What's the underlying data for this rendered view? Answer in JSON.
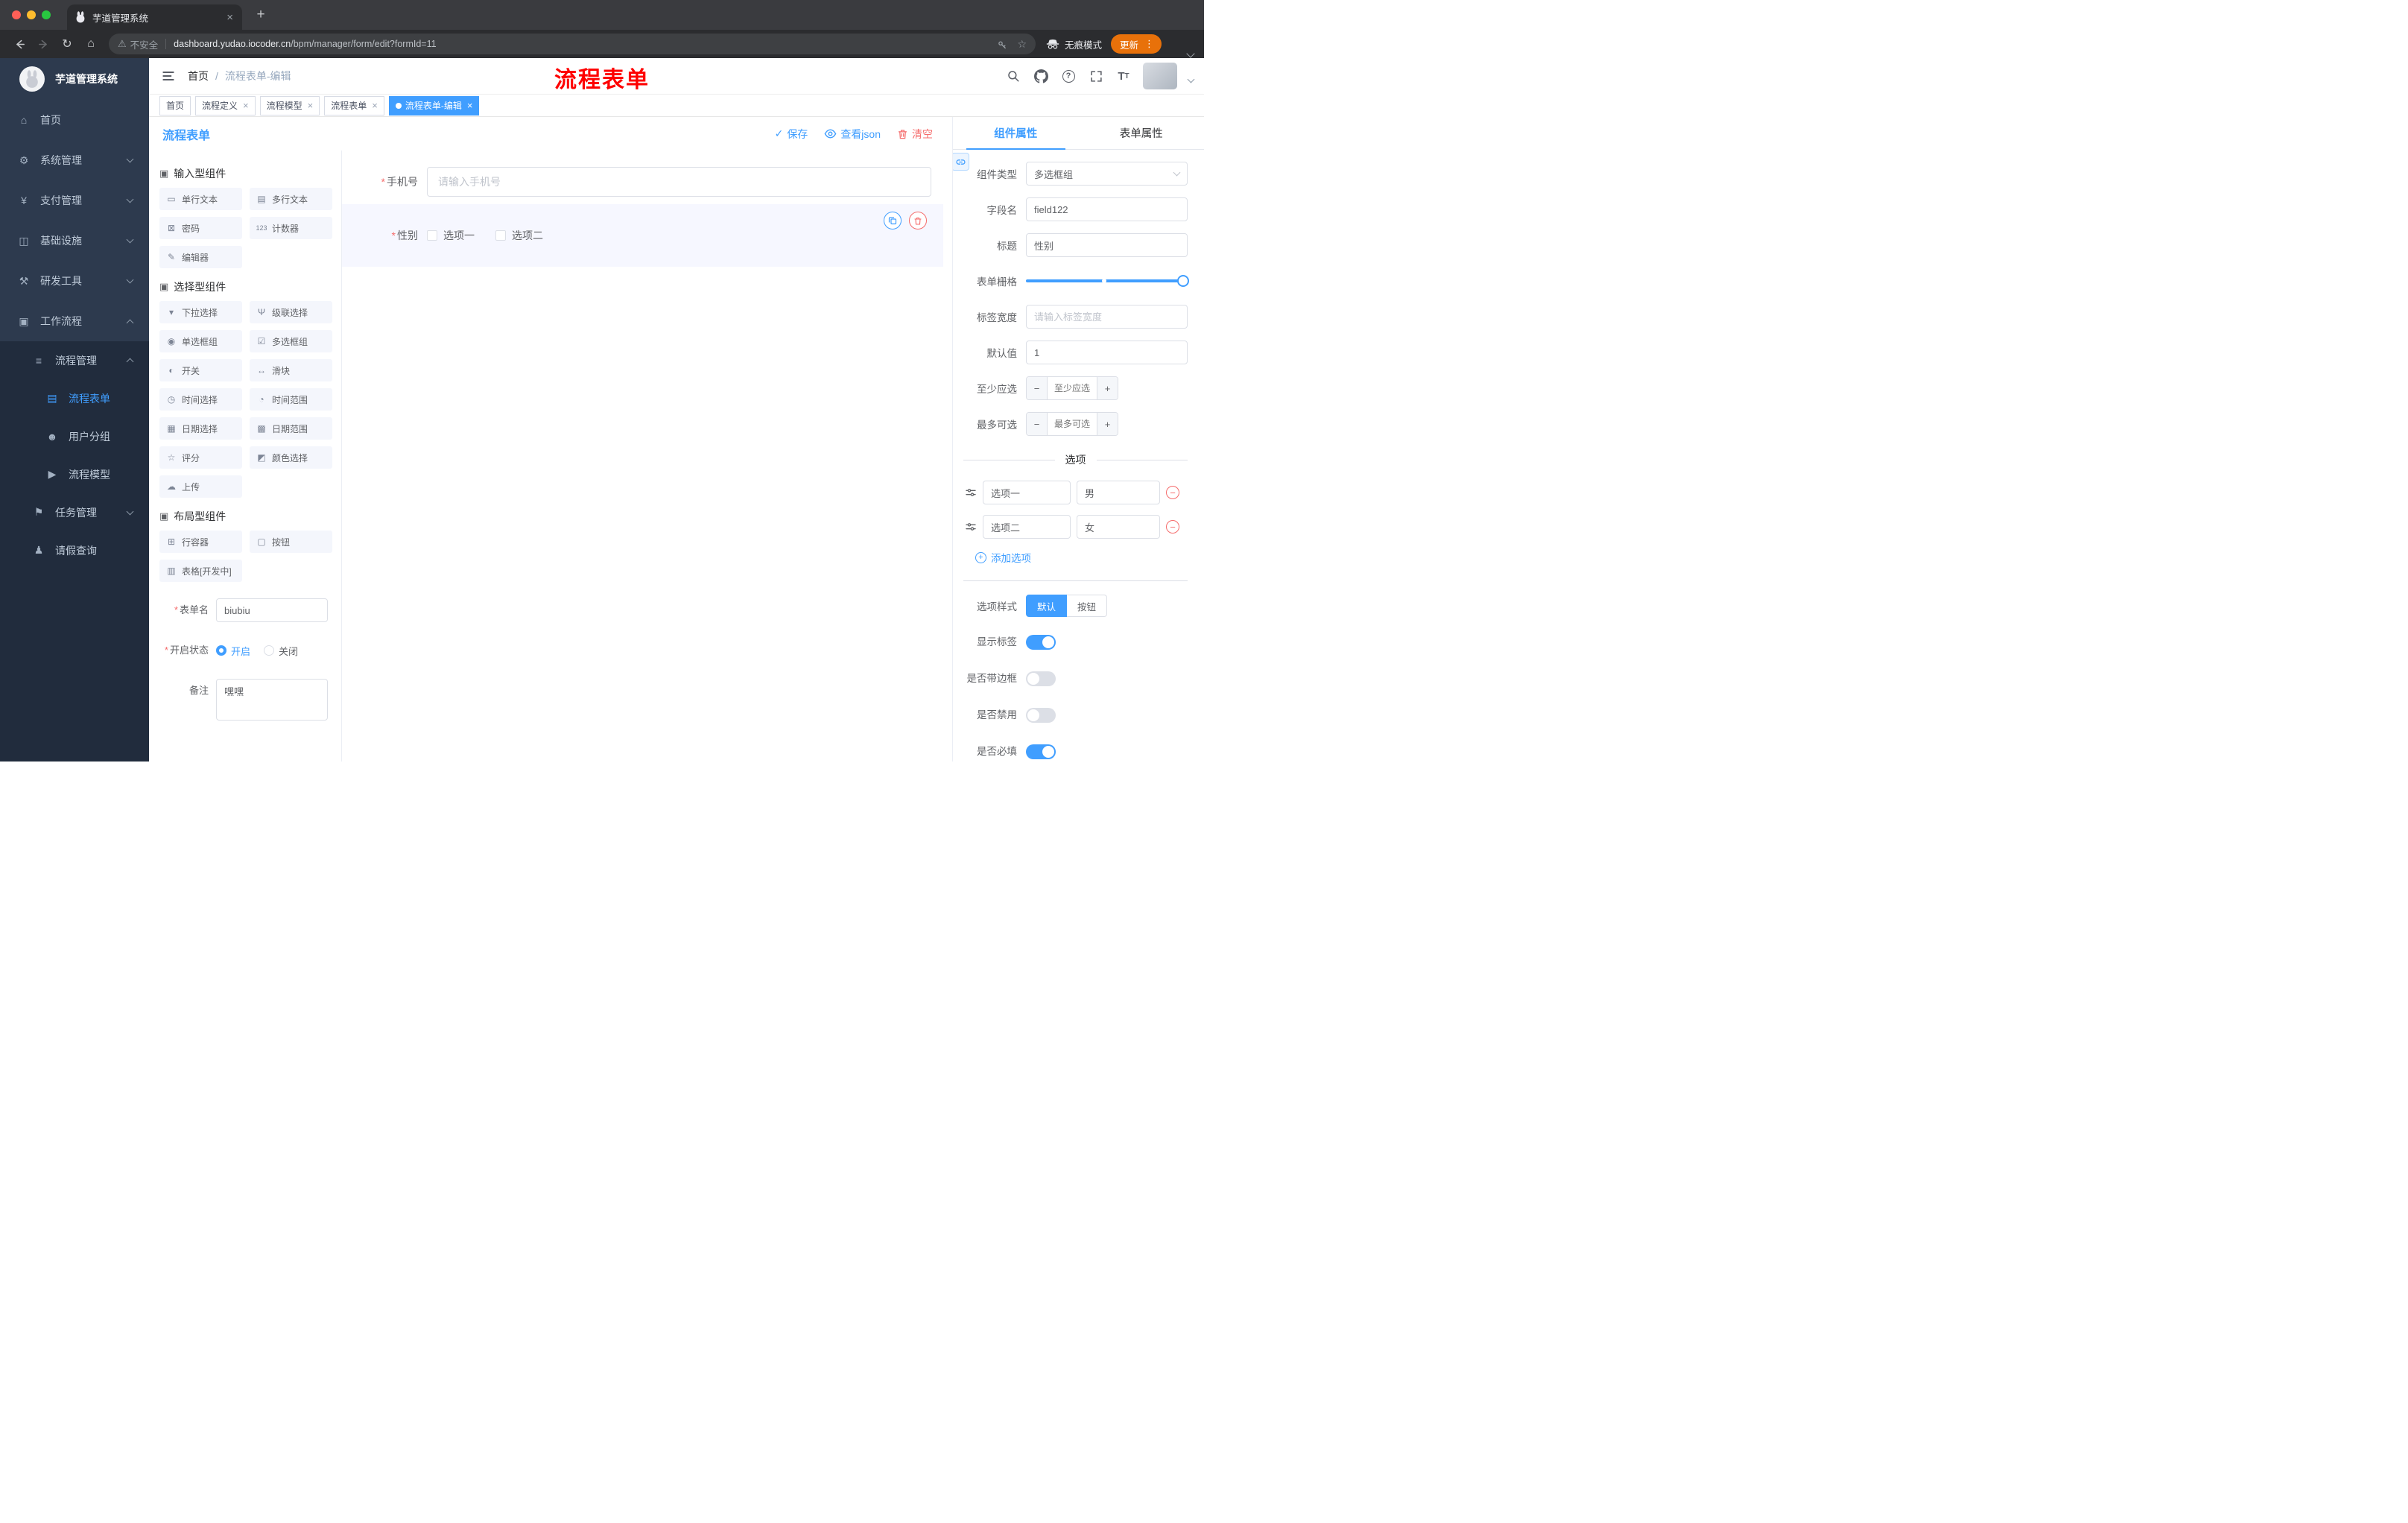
{
  "glyphs": {
    "close": "×",
    "plus": "+",
    "minus": "−",
    "check": "✓",
    "question": "?",
    "kebab": "⋮",
    "reload": "↻",
    "home": "⌂",
    "warning": "⚠",
    "star": "☆",
    "required": "*",
    "text_icon": "T"
  },
  "browser": {
    "tab_title": "芋道管理系统",
    "security_label": "不安全",
    "url_domain": "dashboard.yudao.iocoder.cn",
    "url_path": "/bpm/manager/form/edit?formId=11",
    "incognito_label": "无痕模式",
    "update_label": "更新"
  },
  "sidebar": {
    "logo_title": "芋道管理系统",
    "items": [
      {
        "glyph": "⌂",
        "label": "首页"
      },
      {
        "glyph": "⚙",
        "label": "系统管理"
      },
      {
        "glyph": "¥",
        "label": "支付管理"
      },
      {
        "glyph": "◫",
        "label": "基础设施"
      },
      {
        "glyph": "⚒",
        "label": "研发工具"
      },
      {
        "glyph": "▣",
        "label": "工作流程"
      },
      {
        "glyph": "≡",
        "label": "流程管理"
      },
      {
        "glyph": "▤",
        "label": "流程表单"
      },
      {
        "glyph": "☻",
        "label": "用户分组"
      },
      {
        "glyph": "▶",
        "label": "流程模型"
      },
      {
        "glyph": "⚑",
        "label": "任务管理"
      },
      {
        "glyph": "♟",
        "label": "请假查询"
      }
    ]
  },
  "header": {
    "breadcrumb_home": "首页",
    "breadcrumb_sep": "/",
    "breadcrumb_current": "流程表单-编辑",
    "annotation": "流程表单"
  },
  "tags": {
    "items": [
      {
        "label": "首页"
      },
      {
        "label": "流程定义"
      },
      {
        "label": "流程模型"
      },
      {
        "label": "流程表单"
      },
      {
        "label": "流程表单-编辑"
      }
    ]
  },
  "editor": {
    "title": "流程表单",
    "actions": {
      "save": "保存",
      "view_json": "查看json",
      "clear": "清空"
    },
    "palette": {
      "sections": [
        {
          "title": "输入型组件",
          "items": [
            {
              "glyph": "▭",
              "label": "单行文本"
            },
            {
              "glyph": "▤",
              "label": "多行文本"
            },
            {
              "glyph": "⊠",
              "label": "密码"
            },
            {
              "glyph": "123",
              "label": "计数器"
            },
            {
              "glyph": "✎",
              "label": "编辑器"
            }
          ]
        },
        {
          "title": "选择型组件",
          "items": [
            {
              "glyph": "▾",
              "label": "下拉选择"
            },
            {
              "glyph": "Ψ",
              "label": "级联选择"
            },
            {
              "glyph": "◉",
              "label": "单选框组"
            },
            {
              "glyph": "☑",
              "label": "多选框组"
            },
            {
              "glyph": "◐",
              "label": "开关"
            },
            {
              "glyph": "↔",
              "label": "滑块"
            },
            {
              "glyph": "◷",
              "label": "时间选择"
            },
            {
              "glyph": "◔",
              "label": "时间范围"
            },
            {
              "glyph": "▦",
              "label": "日期选择"
            },
            {
              "glyph": "▩",
              "label": "日期范围"
            },
            {
              "glyph": "☆",
              "label": "评分"
            },
            {
              "glyph": "◩",
              "label": "颜色选择"
            },
            {
              "glyph": "☁",
              "label": "上传"
            }
          ]
        },
        {
          "title": "布局型组件",
          "items": [
            {
              "glyph": "⊞",
              "label": "行容器"
            },
            {
              "glyph": "▢",
              "label": "按钮"
            },
            {
              "glyph": "▥",
              "label": "表格[开发中]"
            }
          ]
        }
      ]
    },
    "meta": {
      "form_name_label": "表单名",
      "form_name_value": "biubiu",
      "status_label": "开启状态",
      "status_on": "开启",
      "status_off": "关闭",
      "remark_label": "备注",
      "remark_value": "嘿嘿"
    },
    "canvas": {
      "phone_label": "手机号",
      "phone_placeholder": "请输入手机号",
      "gender_label": "性别",
      "gender_option1": "选项一",
      "gender_option2": "选项二"
    },
    "props": {
      "tab_component": "组件属性",
      "tab_form": "表单属性",
      "component_type_label": "组件类型",
      "component_type_value": "多选框组",
      "field_name_label": "字段名",
      "field_name_value": "field122",
      "title_label": "标题",
      "title_value": "性别",
      "grid_label": "表单栅格",
      "label_width_label": "标签宽度",
      "label_width_placeholder": "请输入标签宽度",
      "default_label": "默认值",
      "default_value": "1",
      "min_label": "至少应选",
      "min_placeholder": "至少应选",
      "max_label": "最多可选",
      "max_placeholder": "最多可选",
      "options_divider": "选项",
      "options": [
        {
          "name": "选项一",
          "value": "男"
        },
        {
          "name": "选项二",
          "value": "女"
        }
      ],
      "add_option": "添加选项",
      "style_label": "选项样式",
      "style_default": "默认",
      "style_button": "按钮",
      "toggles": [
        {
          "label": "显示标签"
        },
        {
          "label": "是否带边框"
        },
        {
          "label": "是否禁用"
        },
        {
          "label": "是否必填"
        }
      ]
    }
  }
}
